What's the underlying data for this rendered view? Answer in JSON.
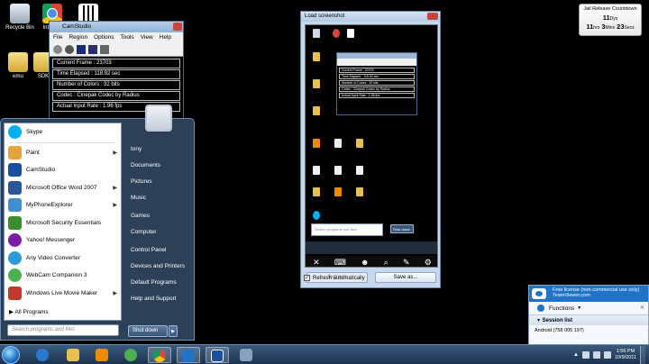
{
  "desktop": {
    "icons": [
      {
        "label": "Recycle Bin",
        "icon": "recycle-bin-icon"
      },
      {
        "label": "Int Ch...",
        "icon": "chrome-icon"
      },
      {
        "label": "emu",
        "icon": "folder-icon"
      },
      {
        "label": "SDK",
        "icon": "folder-icon"
      },
      {
        "label": "",
        "icon": "qr-code-icon"
      }
    ]
  },
  "camstudio": {
    "title": "CamStudio",
    "menu": [
      "File",
      "Region",
      "Options",
      "Tools",
      "View",
      "Help"
    ],
    "stats": [
      "Current Frame : 23703",
      "Time Elapsed : 118.92 sec",
      "Number of Colors : 32 bits",
      "Codec : Cinepak Codec by Radius",
      "Actual Input Rate : 1.96 fps"
    ]
  },
  "start_menu": {
    "programs": [
      {
        "label": "Skype",
        "color": "#00aff0",
        "arrow": false
      },
      {
        "label": "Paint",
        "color": "#e6a23c",
        "arrow": true
      },
      {
        "label": "CamStudio",
        "color": "#1a4fa0",
        "arrow": false
      },
      {
        "label": "Microsoft Office Word 2007",
        "color": "#2b579a",
        "arrow": true
      },
      {
        "label": "MyPhoneExplorer",
        "color": "#3f8fd2",
        "arrow": true
      },
      {
        "label": "Microsoft Security Essentials",
        "color": "#3c8d2f",
        "arrow": false
      },
      {
        "label": "Yahoo! Messenger",
        "color": "#7b1fa2",
        "arrow": false
      },
      {
        "label": "Any Video Converter",
        "color": "#2a9bd8",
        "arrow": false
      },
      {
        "label": "WebCam Companion 3",
        "color": "#4caf50",
        "arrow": false
      },
      {
        "label": "Windows Live Movie Maker",
        "color": "#c0392b",
        "arrow": true
      }
    ],
    "all_programs": "All Programs",
    "search_placeholder": "Search programs and files",
    "user": "tony",
    "right_items": [
      "Documents",
      "Pictures",
      "Music",
      "Games",
      "Computer",
      "Control Panel",
      "Devices and Printers",
      "Default Programs",
      "Help and Support"
    ],
    "shutdown": "Shut down"
  },
  "load_window": {
    "title": "Load screenshot",
    "refresh": "Refresh",
    "save": "Save as...",
    "auto_refresh": "Refresh automatically",
    "auto_refresh_checked": true
  },
  "countdown": {
    "title": "Jail Release Countdown",
    "days": "11",
    "days_unit": "Dys",
    "hours": "11",
    "hours_unit": "hrs",
    "mins": "3",
    "mins_unit": "Mins",
    "secs": "23",
    "secs_unit": "Secs"
  },
  "teamviewer": {
    "banner_line1": "Free license (non-commercial use only)",
    "banner_line2": "TeamViewer.com",
    "functions": "Functions",
    "session_list": "Session list",
    "session": "Android (758 005 197)"
  },
  "taskbar": {
    "time": "1:56 PM",
    "date": "10/9/2011"
  }
}
